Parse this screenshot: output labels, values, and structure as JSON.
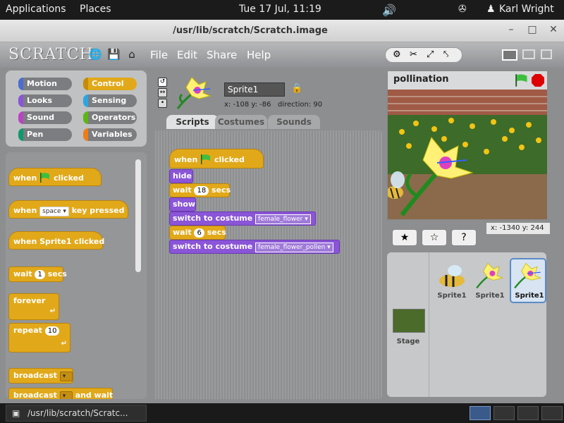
{
  "topbar": {
    "applications": "Applications",
    "places": "Places",
    "clock": "Tue 17 Jul, 11:19",
    "user": "Karl Wright"
  },
  "window": {
    "title": "/usr/lib/scratch/Scratch.image"
  },
  "app": {
    "logo": "SCRATCH",
    "menu": {
      "file": "File",
      "edit": "Edit",
      "share": "Share",
      "help": "Help"
    },
    "categories": [
      {
        "label": "Motion",
        "color": "#4a6cd4"
      },
      {
        "label": "Control",
        "color": "#e1a91a"
      },
      {
        "label": "Looks",
        "color": "#8a55d7"
      },
      {
        "label": "Sensing",
        "color": "#2ca5e2"
      },
      {
        "label": "Sound",
        "color": "#bb42c3"
      },
      {
        "label": "Operators",
        "color": "#5cb712"
      },
      {
        "label": "Pen",
        "color": "#0e9a6c"
      },
      {
        "label": "Variables",
        "color": "#ee7d16"
      }
    ],
    "palette": {
      "when_flag": "when",
      "when_flag_suffix": "clicked",
      "when_key": "when",
      "when_key_value": "space",
      "when_key_suffix": "key pressed",
      "when_sprite": "when Sprite1 clicked",
      "wait": "wait",
      "wait_value": "1",
      "wait_suffix": "secs",
      "forever": "forever",
      "repeat": "repeat",
      "repeat_value": "10",
      "broadcast": "broadcast",
      "broadcast_wait": "broadcast",
      "broadcast_wait_suffix": "and wait"
    },
    "sprite": {
      "name": "Sprite1",
      "x_label": "x:",
      "x": "-108",
      "y_label": "y:",
      "y": "-86",
      "direction_label": "direction:",
      "direction": "90"
    },
    "tabs": {
      "scripts": "Scripts",
      "costumes": "Costumes",
      "sounds": "Sounds"
    },
    "script": {
      "hat": "when",
      "hat_suffix": "clicked",
      "hide": "hide",
      "wait1": "wait",
      "wait1_value": "18",
      "wait1_suffix": "secs",
      "show": "show",
      "switch1": "switch to costume",
      "switch1_value": "female_flower",
      "wait2": "wait",
      "wait2_value": "6",
      "wait2_suffix": "secs",
      "switch2": "switch to costume",
      "switch2_value": "female_flower_pollen"
    },
    "stage": {
      "title": "pollination",
      "mouse_x_label": "x:",
      "mouse_x": "-1340",
      "mouse_y_label": "y:",
      "mouse_y": "244"
    },
    "sprites": [
      {
        "name": "Sprite1"
      },
      {
        "name": "Sprite1"
      },
      {
        "name": "Sprite1"
      }
    ],
    "stage_thumb": "Stage"
  },
  "taskbar": {
    "task": "/usr/lib/scratch/Scratc..."
  }
}
